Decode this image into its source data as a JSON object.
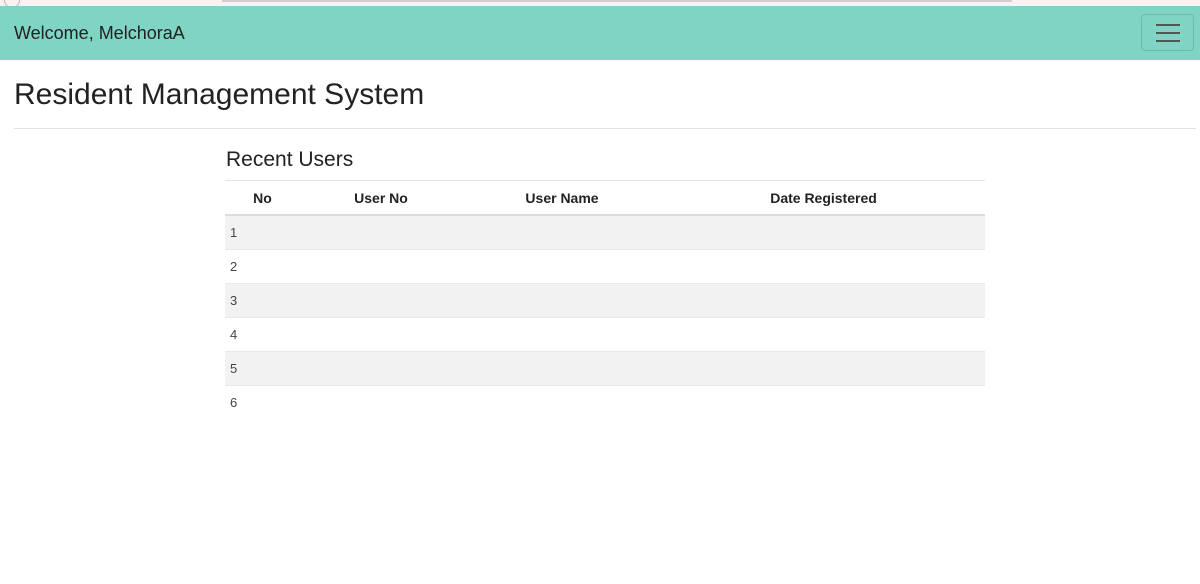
{
  "navbar": {
    "welcome": "Welcome, MelchoraA",
    "toggler_icon": "hamburger-menu-icon",
    "background": "#7fd4c4"
  },
  "page": {
    "title": "Resident Management System"
  },
  "recent_users": {
    "title": "Recent Users",
    "columns": [
      "No",
      "User No",
      "User Name",
      "Date Registered"
    ],
    "rows": [
      {
        "no": "1",
        "user_no": "",
        "user_name": "",
        "date_registered": ""
      },
      {
        "no": "2",
        "user_no": "",
        "user_name": "",
        "date_registered": ""
      },
      {
        "no": "3",
        "user_no": "",
        "user_name": "",
        "date_registered": ""
      },
      {
        "no": "4",
        "user_no": "",
        "user_name": "",
        "date_registered": ""
      },
      {
        "no": "5",
        "user_no": "",
        "user_name": "",
        "date_registered": ""
      },
      {
        "no": "6",
        "user_no": "",
        "user_name": "",
        "date_registered": ""
      }
    ]
  }
}
